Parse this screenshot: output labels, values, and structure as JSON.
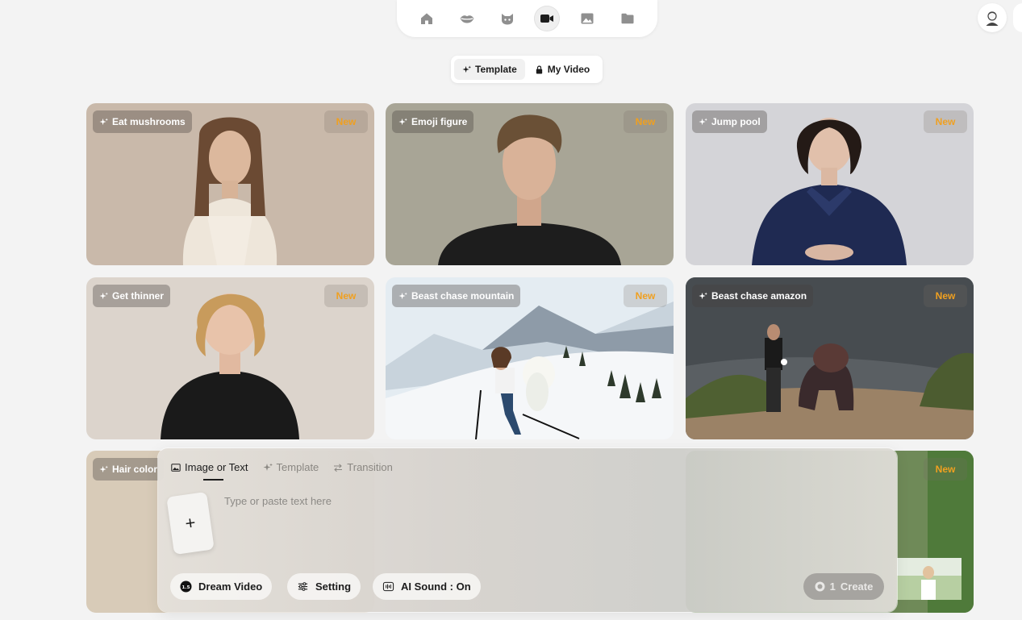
{
  "nav": {
    "items": [
      {
        "name": "home-icon",
        "active": false
      },
      {
        "name": "lips-icon",
        "active": false
      },
      {
        "name": "cat-icon",
        "active": false
      },
      {
        "name": "video-camera-icon",
        "active": true
      },
      {
        "name": "image-icon",
        "active": false
      },
      {
        "name": "folder-icon",
        "active": false
      }
    ]
  },
  "segment": {
    "template_label": "Template",
    "my_video_label": "My Video"
  },
  "cards": [
    {
      "label": "Eat mushrooms",
      "badge": "New"
    },
    {
      "label": "Emoji figure",
      "badge": "New"
    },
    {
      "label": "Jump pool",
      "badge": "New"
    },
    {
      "label": "Get thinner",
      "badge": "New"
    },
    {
      "label": "Beast chase mountain",
      "badge": "New"
    },
    {
      "label": "Beast chase amazon",
      "badge": "New"
    },
    {
      "label": "Hair color",
      "badge": ""
    },
    {
      "label": "",
      "badge": "New"
    }
  ],
  "composer": {
    "tabs": [
      "Image or Text",
      "Template",
      "Transition"
    ],
    "upload_symbol": "+",
    "placeholder": "Type or paste text here",
    "model_badge": "1.5",
    "model_label": "Dream Video",
    "setting_label": "Setting",
    "sound_label": "AI Sound : On",
    "create_cost": "1",
    "create_label": "Create"
  },
  "colors": {
    "accent_new": "#f0a020",
    "create_disabled": "#a6a4a0"
  }
}
